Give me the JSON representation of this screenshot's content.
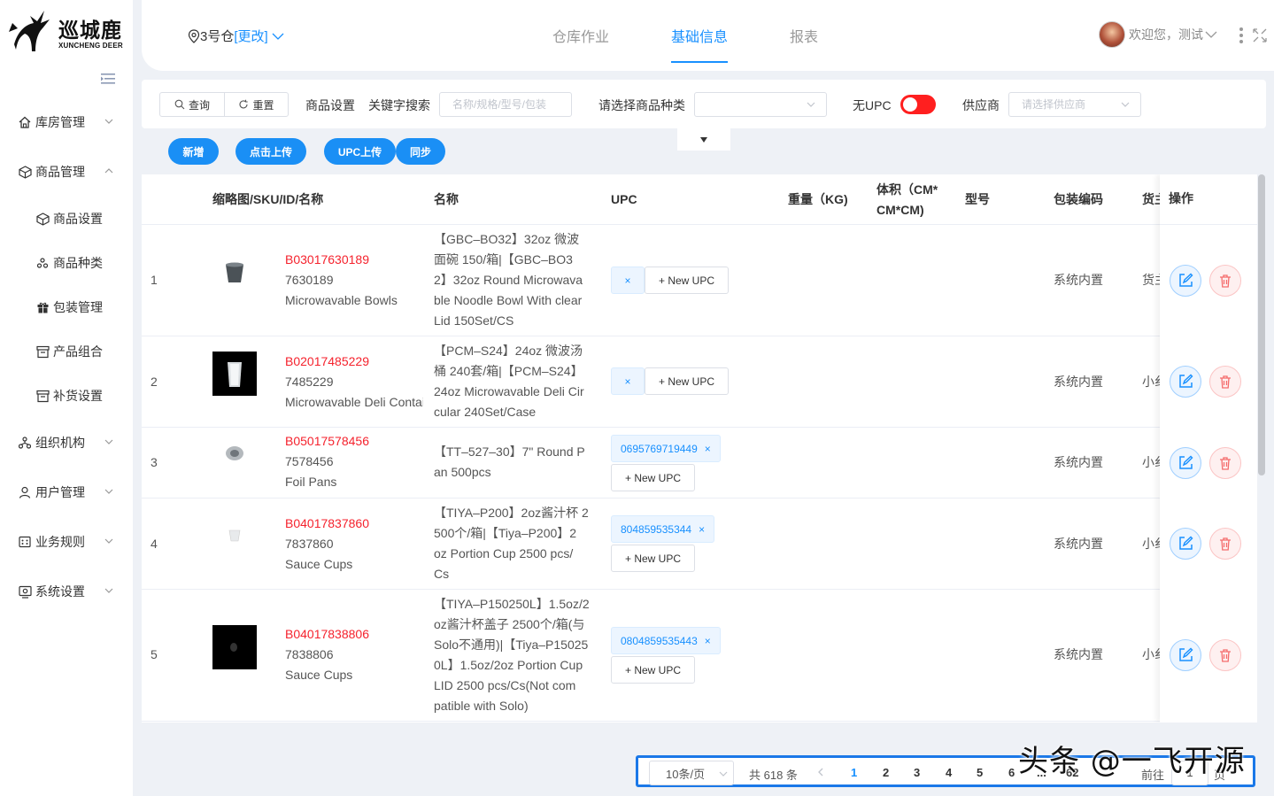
{
  "brand": {
    "name_cn": "巡城鹿",
    "name_en": "XUNCHENG DEER"
  },
  "header": {
    "warehouse": "3号仓",
    "change": "[更改]",
    "tabs": [
      "仓库作业",
      "基础信息",
      "报表"
    ],
    "active_tab": "基础信息",
    "greeting": "欢迎您，测试"
  },
  "sidebar": {
    "items": [
      {
        "label": "库房管理",
        "icon": "home-icon",
        "expanded": false
      },
      {
        "label": "商品管理",
        "icon": "box-icon",
        "expanded": true,
        "children": [
          {
            "label": "商品设置",
            "icon": "cube-icon"
          },
          {
            "label": "商品种类",
            "icon": "cluster-icon"
          },
          {
            "label": "包装管理",
            "icon": "gift-icon"
          },
          {
            "label": "产品组合",
            "icon": "archive-icon"
          },
          {
            "label": "补货设置",
            "icon": "archive-icon"
          }
        ]
      },
      {
        "label": "组织机构",
        "icon": "org-icon",
        "expanded": false
      },
      {
        "label": "用户管理",
        "icon": "user-icon",
        "expanded": false
      },
      {
        "label": "业务规则",
        "icon": "rules-icon",
        "expanded": false
      },
      {
        "label": "系统设置",
        "icon": "settings-icon",
        "expanded": false
      }
    ]
  },
  "filter": {
    "query_btn": "查询",
    "reset_btn": "重置",
    "product_setting": "商品设置",
    "keyword_label": "关键字搜索",
    "keyword_placeholder": "名称/规格/型号/包装",
    "category_label": "请选择商品种类",
    "category_value": "",
    "no_upc_label": "无UPC",
    "no_upc_on": true,
    "supplier_label": "供应商",
    "supplier_placeholder": "请选择供应商"
  },
  "actions": {
    "add": "新增",
    "upload": "点击上传",
    "upc_upload": "UPC上传",
    "sync": "同步"
  },
  "table": {
    "columns": {
      "thumb": "缩略图/SKU/ID/名称",
      "name": "名称",
      "upc": "UPC",
      "weight": "重量（KG)",
      "volume_1": "体积（CM*",
      "volume_2": "CM*CM)",
      "model": "型号",
      "pack_code": "包装编码",
      "owner": "货主",
      "ops": "操作"
    },
    "rows": [
      {
        "idx": "1",
        "sku": "B03017630189",
        "id": "7630189",
        "short": "Microwavable Bowls",
        "name": [
          "【GBC–BO32】32oz 微波",
          "面碗 150/箱|【GBC–BO3",
          "2】32oz Round Microwava",
          "ble Noodle Bowl With clear",
          "Lid 150Set/CS"
        ],
        "upc": "",
        "new_upc": "+ New UPC",
        "pack_code": "系统内置",
        "owner": "货主"
      },
      {
        "idx": "2",
        "sku": "B02017485229",
        "id": "7485229",
        "short": "Microwavable Deli Contai",
        "name": [
          "【PCM–S24】24oz 微波汤",
          "桶 240套/箱|【PCM–S24】",
          "24oz Microwavable Deli Cir",
          "cular 240Set/Case"
        ],
        "upc": "",
        "new_upc": "+ New UPC",
        "pack_code": "系统内置",
        "owner": "小纟"
      },
      {
        "idx": "3",
        "sku": "B05017578456",
        "id": "7578456",
        "short": "Foil Pans",
        "name": [
          "【TT–527–30】7\" Round P",
          "an 500pcs"
        ],
        "upc": "0695769719449",
        "new_upc": "+ New UPC",
        "pack_code": "系统内置",
        "owner": "小纟"
      },
      {
        "idx": "4",
        "sku": "B04017837860",
        "id": "7837860",
        "short": "Sauce Cups",
        "name": [
          "【TIYA–P200】2oz酱汁杯 2",
          "500个/箱|【Tiya–P200】2",
          "oz Portion Cup 2500 pcs/",
          "Cs"
        ],
        "upc": "804859535344",
        "new_upc": "+ New UPC",
        "pack_code": "系统内置",
        "owner": "小纟"
      },
      {
        "idx": "5",
        "sku": "B04017838806",
        "id": "7838806",
        "short": "Sauce Cups",
        "name": [
          "【TIYA–P150250L】1.5oz/2",
          "oz酱汁杯盖子 2500个/箱(与",
          "Solo不通用)|【Tiya–P15025",
          "0L】1.5oz/2oz Portion Cup",
          "LID 2500 pcs/Cs(Not com",
          "patible with Solo)"
        ],
        "upc": "0804859535443",
        "new_upc": "+ New UPC",
        "pack_code": "系统内置",
        "owner": "小纟"
      }
    ]
  },
  "pagination": {
    "page_size": "10条/页",
    "total": "共 618 条",
    "pages": [
      "1",
      "2",
      "3",
      "4",
      "5",
      "6",
      "...",
      "62"
    ],
    "current": "1",
    "goto": "前往",
    "input": "1",
    "unit": "页"
  },
  "watermark": "头条 @一飞开源",
  "colors": {
    "accent": "#1890ff",
    "sku": "#f5222d",
    "toggle_on": "#ff1f1f",
    "pager_border": "#1a78e8"
  }
}
